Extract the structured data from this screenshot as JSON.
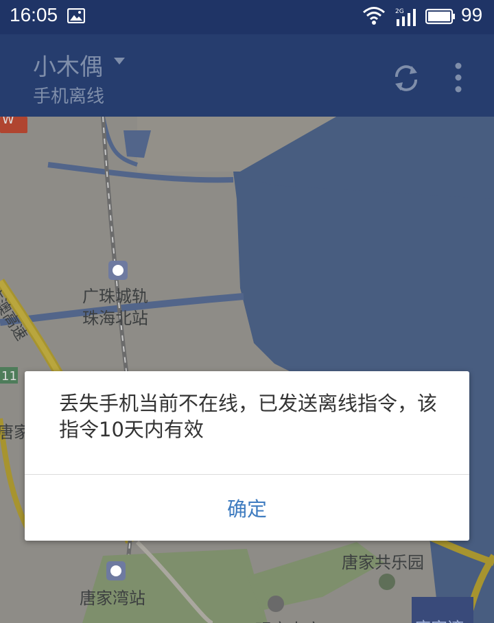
{
  "status_bar": {
    "time": "16:05",
    "battery_level": "99",
    "network": "2G"
  },
  "app_bar": {
    "title": "小木偶",
    "subtitle": "手机离线"
  },
  "map": {
    "labels": {
      "station_line1": "广珠城轨",
      "station_line2": "珠海北站",
      "expressway": "广澳高速",
      "tangjia_left": "唐家",
      "tangjia_bay_station": "唐家湾站",
      "tangjia_park": "唐家共乐园",
      "guanyin_temple": "观音古庙",
      "tangjiawan_bottom": "唐家湾",
      "road_num": "11",
      "top_left_badge": "W"
    }
  },
  "dialog": {
    "message": "丢失手机当前不在线，已发送离线指令，该指令10天内有效",
    "ok_label": "确定"
  },
  "colors": {
    "status_bar": "#1f3466",
    "app_bar": "#263d6e",
    "accent": "#3f7cc0"
  }
}
